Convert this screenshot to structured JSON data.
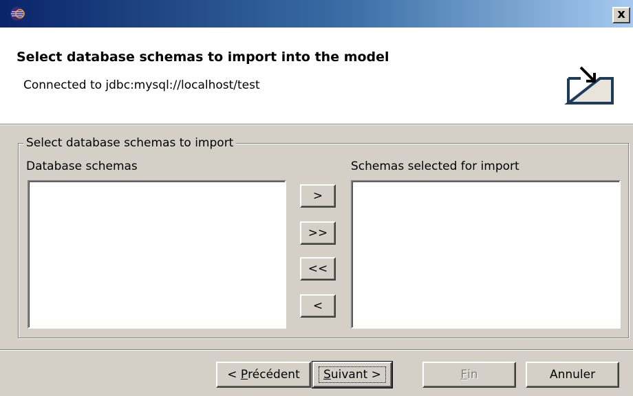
{
  "titlebar": {
    "close_label": "x"
  },
  "header": {
    "title": "Select database schemas to import into the model",
    "subtitle": "Connected to jdbc:mysql://localhost/test"
  },
  "group": {
    "legend": "Select database schemas to import",
    "left_list_label": "Database schemas",
    "right_list_label": "Schemas selected for import",
    "left_items": [],
    "right_items": []
  },
  "transfer_buttons": {
    "add": ">",
    "add_all": ">>",
    "remove_all": "<<",
    "remove": "<"
  },
  "footer": {
    "back_prefix": "< ",
    "back_mnemonic": "P",
    "back_rest": "récédent",
    "next_mnemonic": "S",
    "next_rest": "uivant >",
    "finish_mnemonic": "F",
    "finish_rest": "in",
    "cancel": "Annuler"
  }
}
